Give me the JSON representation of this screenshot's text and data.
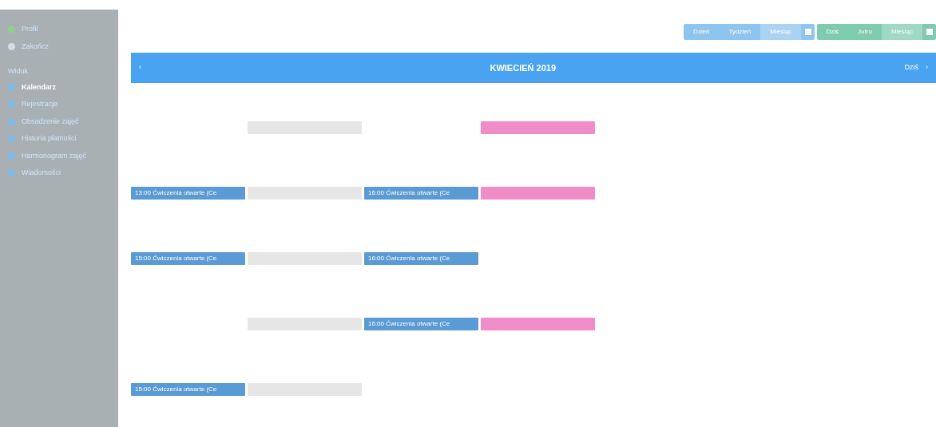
{
  "sidebar": {
    "top_items": [
      {
        "label": "Profil"
      },
      {
        "label": "Zakończ"
      }
    ],
    "section_title": "Widok",
    "items": [
      {
        "label": "Kalendarz",
        "selected": true
      },
      {
        "label": "Rejestracje",
        "selected": false
      },
      {
        "label": "Obsadzenie zajęć",
        "selected": false
      },
      {
        "label": "Historia płatności",
        "selected": false
      },
      {
        "label": "Harmonogram zajęć",
        "selected": false
      },
      {
        "label": "Wiadomości",
        "selected": false
      }
    ]
  },
  "view_buttons": [
    {
      "label": "Dzień",
      "selected": false
    },
    {
      "label": "Tydzień",
      "selected": false
    },
    {
      "label": "Miesiąc",
      "selected": true
    }
  ],
  "filter_buttons": [
    {
      "label": "Dziś",
      "selected": false
    },
    {
      "label": "Jutro",
      "selected": false
    },
    {
      "label": "Miesiąc",
      "selected": true
    }
  ],
  "calendar": {
    "title": "KWIECIEŃ 2019",
    "prev": "‹",
    "today": "Dziś",
    "next": "›",
    "weeks": [
      {
        "cells": [
          {
            "kind": "empty"
          },
          {
            "kind": "bar",
            "color": "#e6e6e6"
          },
          {
            "kind": "empty"
          },
          {
            "kind": "bar",
            "color": "#f08cc8"
          }
        ]
      },
      {
        "cells": [
          {
            "kind": "event",
            "color": "#5b9bd5",
            "label": "13:00 Ćwiczenia otwarte (Ce"
          },
          {
            "kind": "bar",
            "color": "#e6e6e6"
          },
          {
            "kind": "event",
            "color": "#5b9bd5",
            "label": "16:00 Ćwiczenia otwarte (Ce"
          },
          {
            "kind": "bar",
            "color": "#f08cc8"
          }
        ]
      },
      {
        "cells": [
          {
            "kind": "event",
            "color": "#5b9bd5",
            "label": "15:00 Ćwiczenia otwarte (Ce"
          },
          {
            "kind": "bar",
            "color": "#e6e6e6"
          },
          {
            "kind": "event",
            "color": "#5b9bd5",
            "label": "16:00 Ćwiczenia otwarte (Ce"
          },
          {
            "kind": "empty"
          }
        ]
      },
      {
        "cells": [
          {
            "kind": "empty"
          },
          {
            "kind": "bar",
            "color": "#e6e6e6"
          },
          {
            "kind": "event",
            "color": "#5b9bd5",
            "label": "16:00 Ćwiczenia otwarte (Ce"
          },
          {
            "kind": "bar",
            "color": "#f08cc8"
          }
        ]
      },
      {
        "cells": [
          {
            "kind": "event",
            "color": "#5b9bd5",
            "label": "15:00 Ćwiczenia otwarte (Ce"
          },
          {
            "kind": "bar",
            "color": "#e6e6e6"
          },
          {
            "kind": "empty"
          },
          {
            "kind": "empty"
          }
        ]
      }
    ]
  }
}
